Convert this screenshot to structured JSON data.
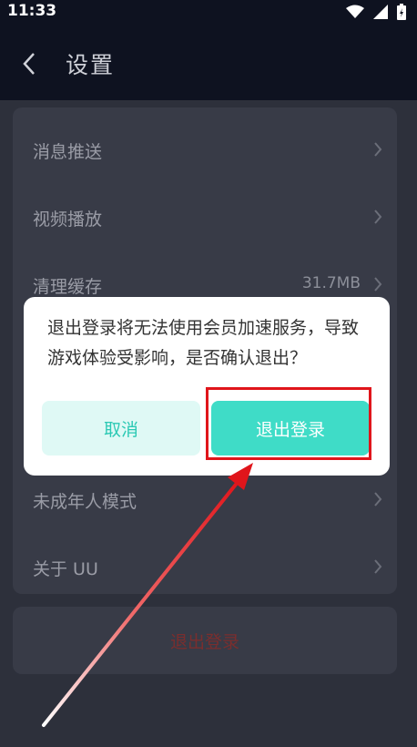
{
  "status_bar": {
    "time": "11:33"
  },
  "header": {
    "title": "设置"
  },
  "settings": {
    "items": [
      {
        "label": "消息推送",
        "value": ""
      },
      {
        "label": "视频播放",
        "value": ""
      },
      {
        "label": "清理缓存",
        "value": "31.7MB"
      },
      {
        "label": "未成年人模式",
        "value": ""
      },
      {
        "label": "关于 UU",
        "value": ""
      }
    ],
    "logout_label": "退出登录"
  },
  "dialog": {
    "message": "退出登录将无法使用会员加速服务，导致游戏体验受影响，是否确认退出？",
    "cancel_label": "取消",
    "confirm_label": "退出登录"
  },
  "colors": {
    "accent": "#3fdcc7",
    "annotation": "#e0151b",
    "logout_text": "#7a2e2e"
  }
}
